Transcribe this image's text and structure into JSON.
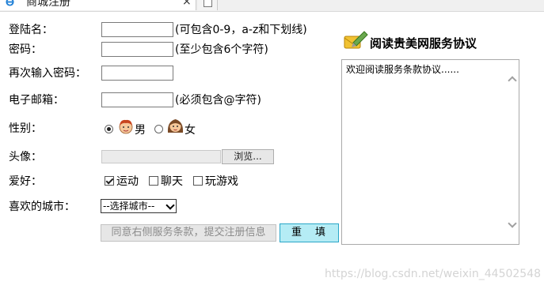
{
  "tab": {
    "title": "商城注册",
    "close": "×"
  },
  "form": {
    "username": {
      "label": "登陆名：",
      "value": "",
      "hint": "(可包含0-9，a-z和下划线)"
    },
    "password": {
      "label": "密码：",
      "value": "",
      "hint": "(至少包含6个字符)"
    },
    "confirm": {
      "label": "再次输入密码：",
      "value": ""
    },
    "email": {
      "label": "电子邮箱：",
      "value": "",
      "hint": "(必须包含@字符)"
    },
    "gender": {
      "label": "性别：",
      "options": [
        "男",
        "女"
      ],
      "selected": "男"
    },
    "avatar": {
      "label": "头像：",
      "browse_label": "浏览..."
    },
    "hobby": {
      "label": "爱好：",
      "options": [
        "运动",
        "聊天",
        "玩游戏"
      ],
      "checked": [
        "运动"
      ]
    },
    "city": {
      "label": "喜欢的城市：",
      "selected": "--选择城市--"
    },
    "submit_label": "同意右侧服务条款，提交注册信息",
    "reset_label": "重　填"
  },
  "agreement": {
    "title": "阅读贵美网服务协议",
    "text": "欢迎阅读服务条款协议......"
  },
  "watermark": "https://blog.csdn.net/weixin_44502548",
  "colors": {
    "reset_bg": "#b5ecf5",
    "reset_border": "#2aa6c8"
  },
  "icons": [
    "ie-icon",
    "new-tab-icon",
    "male-avatar-icon",
    "female-avatar-icon",
    "pen-icon"
  ]
}
